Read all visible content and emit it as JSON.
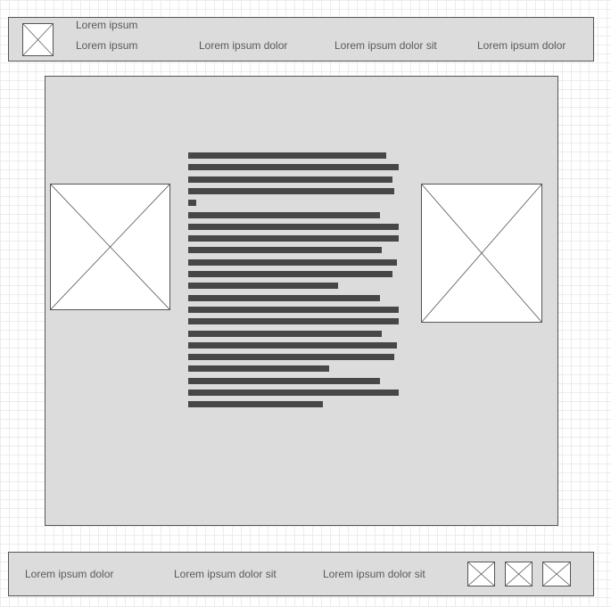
{
  "header": {
    "logo_icon": "placeholder-image-icon",
    "site_title": "Lorem ipsum",
    "nav": [
      "Lorem ipsum",
      "Lorem ipsum dolor",
      "Lorem ipsum dolor sit",
      "Lorem ipsum dolor"
    ]
  },
  "main": {
    "left_image_icon": "placeholder-image-icon",
    "right_image_icon": "placeholder-image-icon",
    "text_block_line_fractions": [
      0.94,
      1.0,
      0.97,
      0.98,
      0.04,
      0.91,
      1.0,
      1.0,
      0.92,
      0.99,
      0.97,
      0.71,
      0.91,
      1.0,
      1.0,
      0.92,
      0.99,
      0.98,
      0.67,
      0.91,
      1.0,
      0.64
    ]
  },
  "footer": {
    "links": [
      "Lorem ipsum dolor",
      "Lorem ipsum dolor sit",
      "Lorem ipsum dolor sit"
    ],
    "icons": [
      "placeholder-image-icon",
      "placeholder-image-icon",
      "placeholder-image-icon"
    ]
  }
}
